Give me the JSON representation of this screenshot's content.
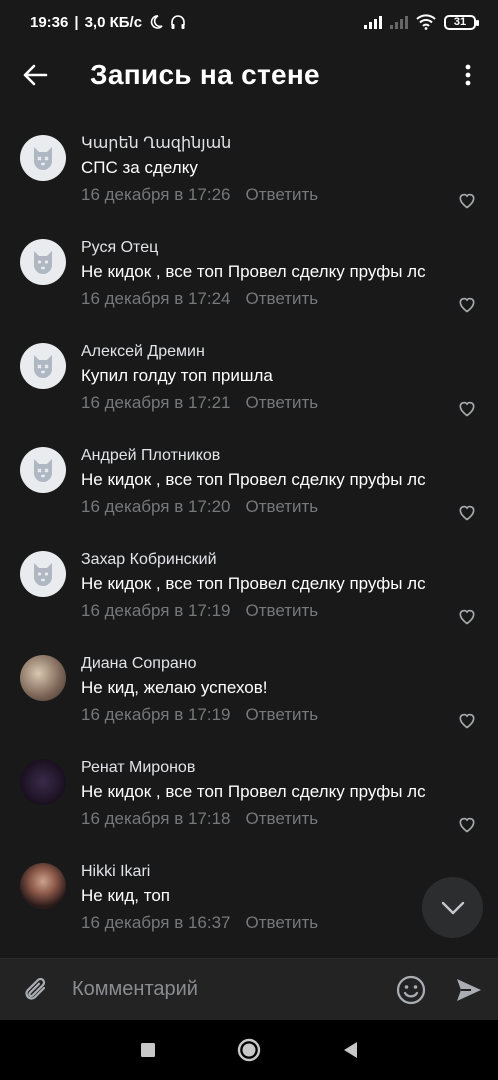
{
  "status": {
    "time": "19:36",
    "speed": "3,0 КБ/с",
    "battery": "31"
  },
  "header": {
    "title": "Запись на стене"
  },
  "comments": [
    {
      "author": "Կարեն Ղազինյան",
      "text": "СПС за сделку",
      "date": "16 декабря в 17:26",
      "reply": "Ответить"
    },
    {
      "author": "Руся Отец",
      "text": "Не кидок , все топ Провел сделку пруфы лс",
      "date": "16 декабря в 17:24",
      "reply": "Ответить"
    },
    {
      "author": "Алексей Дремин",
      "text": "Купил голду топ пришла",
      "date": "16 декабря в 17:21",
      "reply": "Ответить"
    },
    {
      "author": "Андрей Плотников",
      "text": "Не кидок , все топ Провел сделку пруфы лс",
      "date": "16 декабря в 17:20",
      "reply": "Ответить"
    },
    {
      "author": "Захар Кобринский",
      "text": "Не кидок , все топ Провел сделку пруфы лс",
      "date": "16 декабря в 17:19",
      "reply": "Ответить"
    },
    {
      "author": "Диана Сопрано",
      "text": "Не кид, желаю успехов!",
      "date": "16 декабря в 17:19",
      "reply": "Ответить"
    },
    {
      "author": "Ренат Миронов",
      "text": "Не кидок , все топ Провел сделку пруфы лс",
      "date": "16 декабря в 17:18",
      "reply": "Ответить"
    },
    {
      "author": "Hikki Ikari",
      "text": "Не кид, топ",
      "date": "16 декабря в 16:37",
      "reply": "Ответить"
    }
  ],
  "composer": {
    "placeholder": "Комментарий"
  },
  "colors": {
    "background": "#19191a",
    "secondary_text": "#76787a",
    "composer_bg": "#232324"
  }
}
